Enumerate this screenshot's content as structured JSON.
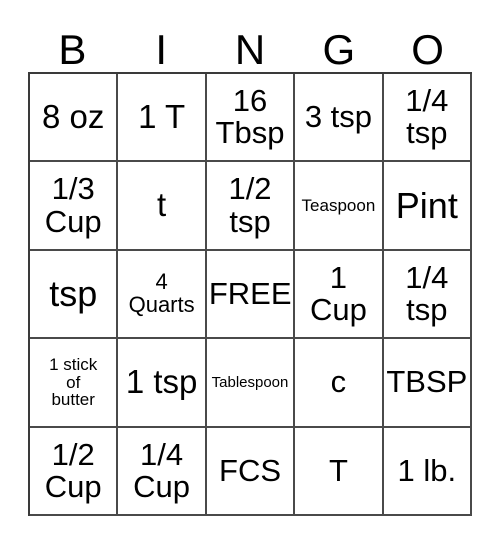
{
  "card": {
    "title_letters": [
      "B",
      "I",
      "N",
      "G",
      "O"
    ],
    "rows": [
      [
        {
          "text": "8 oz",
          "size": "fs-lg"
        },
        {
          "text": "1 T",
          "size": "fs-lg"
        },
        {
          "text": "16\nTbsp",
          "size": "fs-md"
        },
        {
          "text": "3 tsp",
          "size": "fs-md"
        },
        {
          "text": "1/4\ntsp",
          "size": "fs-md"
        }
      ],
      [
        {
          "text": "1/3\nCup",
          "size": "fs-md"
        },
        {
          "text": "t",
          "size": "fs-lg"
        },
        {
          "text": "1/2\ntsp",
          "size": "fs-md"
        },
        {
          "text": "Teaspoon",
          "size": "fs-xs"
        },
        {
          "text": "Pint",
          "size": "fs-xl"
        }
      ],
      [
        {
          "text": "tsp",
          "size": "fs-xl"
        },
        {
          "text": "4\nQuarts",
          "size": "fs-sm"
        },
        {
          "text": "FREE",
          "size": "fs-md"
        },
        {
          "text": "1\nCup",
          "size": "fs-md"
        },
        {
          "text": "1/4\ntsp",
          "size": "fs-md"
        }
      ],
      [
        {
          "text": "1 stick\nof\nbutter",
          "size": "fs-xs"
        },
        {
          "text": "1 tsp",
          "size": "fs-lg"
        },
        {
          "text": "Tablespoon",
          "size": "fs-xxs"
        },
        {
          "text": "c",
          "size": "fs-md"
        },
        {
          "text": "TBSP",
          "size": "fs-md"
        }
      ],
      [
        {
          "text": "1/2\nCup",
          "size": "fs-md"
        },
        {
          "text": "1/4\nCup",
          "size": "fs-md"
        },
        {
          "text": "FCS",
          "size": "fs-md"
        },
        {
          "text": "T",
          "size": "fs-md"
        },
        {
          "text": "1 lb.",
          "size": "fs-md"
        }
      ]
    ],
    "colors": {
      "background": "#ffffff",
      "text": "#000000",
      "grid_border": "#3a3a3a",
      "cell_border": "#4a4a4a"
    }
  }
}
